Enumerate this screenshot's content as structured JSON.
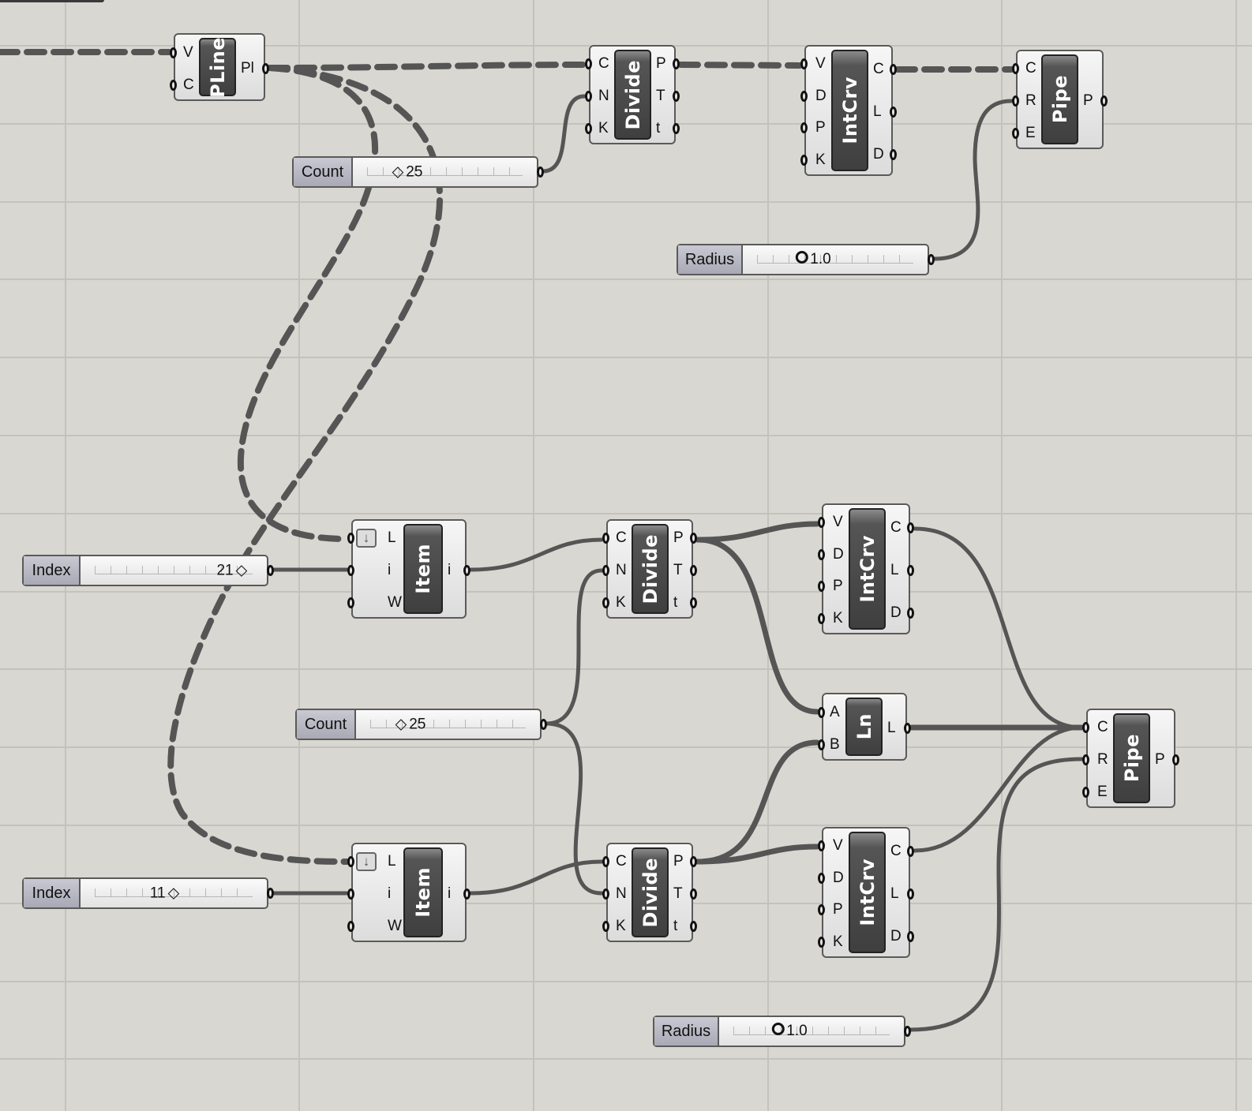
{
  "canvas": {
    "background": "#d9d7d1",
    "wire_color": "#555555"
  },
  "components": [
    {
      "id": "pline",
      "name": "PLine",
      "inputs": [
        "V",
        "C"
      ],
      "outputs": [
        "Pl"
      ]
    },
    {
      "id": "divide1",
      "name": "Divide",
      "inputs": [
        "C",
        "N",
        "K"
      ],
      "outputs": [
        "P",
        "T",
        "t"
      ]
    },
    {
      "id": "intcrv1",
      "name": "IntCrv",
      "inputs": [
        "V",
        "D",
        "P",
        "K"
      ],
      "outputs": [
        "C",
        "L",
        "D"
      ]
    },
    {
      "id": "pipe1",
      "name": "Pipe",
      "inputs": [
        "C",
        "R",
        "E"
      ],
      "outputs": [
        "P"
      ]
    },
    {
      "id": "item1",
      "name": "Item",
      "inputs": [
        "L",
        "i",
        "W"
      ],
      "outputs": [
        "i"
      ]
    },
    {
      "id": "divide2",
      "name": "Divide",
      "inputs": [
        "C",
        "N",
        "K"
      ],
      "outputs": [
        "P",
        "T",
        "t"
      ]
    },
    {
      "id": "intcrv2",
      "name": "IntCrv",
      "inputs": [
        "V",
        "D",
        "P",
        "K"
      ],
      "outputs": [
        "C",
        "L",
        "D"
      ]
    },
    {
      "id": "ln",
      "name": "Ln",
      "inputs": [
        "A",
        "B"
      ],
      "outputs": [
        "L"
      ]
    },
    {
      "id": "pipe2",
      "name": "Pipe",
      "inputs": [
        "C",
        "R",
        "E"
      ],
      "outputs": [
        "P"
      ]
    },
    {
      "id": "item2",
      "name": "Item",
      "inputs": [
        "L",
        "i",
        "W"
      ],
      "outputs": [
        "i"
      ]
    },
    {
      "id": "divide3",
      "name": "Divide",
      "inputs": [
        "C",
        "N",
        "K"
      ],
      "outputs": [
        "P",
        "T",
        "t"
      ]
    },
    {
      "id": "intcrv3",
      "name": "IntCrv",
      "inputs": [
        "V",
        "D",
        "P",
        "K"
      ],
      "outputs": [
        "C",
        "L",
        "D"
      ]
    }
  ],
  "sliders": [
    {
      "id": "count1",
      "label": "Count",
      "value": "25",
      "marker": "diamond",
      "level": 0.25
    },
    {
      "id": "radius1",
      "label": "Radius",
      "value": "1.0",
      "marker": "circle",
      "level": 0.35
    },
    {
      "id": "index1",
      "label": "Index",
      "value": "21",
      "marker": "diamond",
      "level": 0.88
    },
    {
      "id": "count2",
      "label": "Count",
      "value": "25",
      "marker": "diamond",
      "level": 0.25
    },
    {
      "id": "index2",
      "label": "Index",
      "value": "11",
      "marker": "diamond",
      "level": 0.45
    },
    {
      "id": "radius2",
      "label": "Radius",
      "value": "1.0",
      "marker": "circle",
      "level": 0.35
    }
  ]
}
